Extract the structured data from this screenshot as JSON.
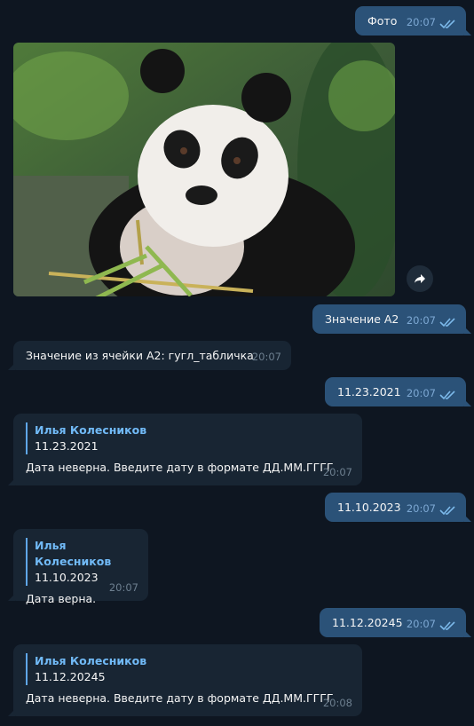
{
  "messages": [
    {
      "text": "Фото",
      "time": "20:07"
    },
    {
      "text": "Значение А2",
      "time": "20:07"
    },
    {
      "text": "Значение из ячейки A2: гугл_табличка",
      "time": "20:07"
    },
    {
      "text": "11.23.2021",
      "time": "20:07"
    },
    {
      "reply_name": "Илья Колесников",
      "reply_text": "11.23.2021",
      "text": "Дата неверна. Введите дату в формате ДД.ММ.ГГГГ",
      "time": "20:07"
    },
    {
      "text": "11.10.2023",
      "time": "20:07"
    },
    {
      "reply_name": "Илья Колесников",
      "reply_text": "11.10.2023",
      "text": "Дата верна.",
      "time": "20:07"
    },
    {
      "text": "11.12.20245",
      "time": "20:07"
    },
    {
      "reply_name": "Илья Колесников",
      "reply_text": "11.12.20245",
      "text": "Дата неверна. Введите дату в формате ДД.ММ.ГГГГ",
      "time": "20:08"
    }
  ],
  "icons": {
    "read_status": "double-check-icon",
    "share": "share-icon"
  },
  "colors": {
    "background": "#0e1621",
    "outgoing": "#2b5278",
    "incoming": "#182533",
    "accent": "#71baf7"
  }
}
